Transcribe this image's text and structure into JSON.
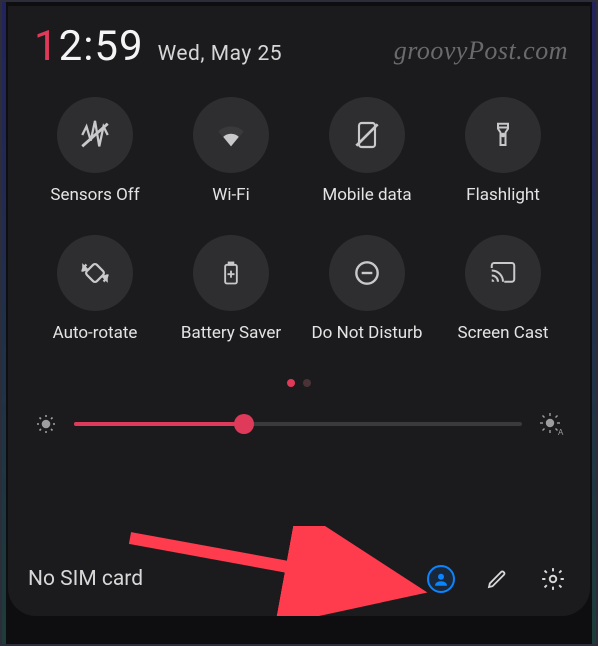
{
  "status": {
    "hour_first": "1",
    "time_rest": "2:59",
    "date": "Wed, May 25"
  },
  "watermark": "groovyPost.com",
  "tiles": [
    {
      "label": "Sensors Off"
    },
    {
      "label": "Wi-Fi"
    },
    {
      "label": "Mobile data"
    },
    {
      "label": "Flashlight"
    },
    {
      "label": "Auto-rotate"
    },
    {
      "label": "Battery Saver"
    },
    {
      "label": "Do Not Disturb"
    },
    {
      "label": "Screen Cast"
    }
  ],
  "pager": {
    "current": 1,
    "total": 2
  },
  "brightness": {
    "percent": 38
  },
  "footer": {
    "sim": "No SIM card"
  },
  "accent": "#e03a5a"
}
